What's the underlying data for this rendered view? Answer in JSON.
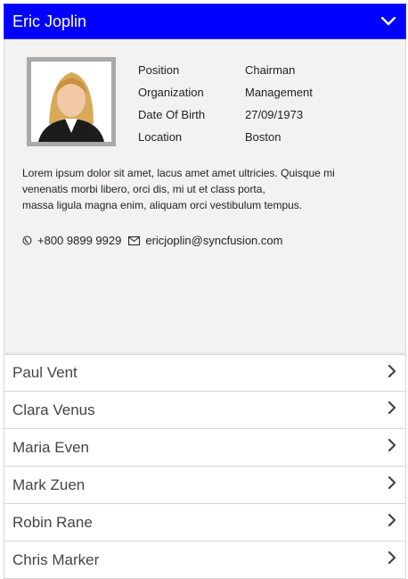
{
  "accordion": {
    "expanded": {
      "name": "Eric Joplin",
      "details": [
        {
          "label": "Position",
          "value": "Chairman"
        },
        {
          "label": "Organization",
          "value": "Management"
        },
        {
          "label": "Date Of Birth",
          "value": "27/09/1973"
        },
        {
          "label": "Location",
          "value": "Boston"
        }
      ],
      "bio_lines": [
        "Lorem ipsum dolor sit amet, lacus amet amet ultricies. Quisque mi",
        "venenatis morbi libero, orci dis, mi ut et class porta,",
        "massa ligula magna enim, aliquam orci vestibulum tempus."
      ],
      "phone": "+800 9899 9929",
      "email": "ericjoplin@syncfusion.com"
    },
    "items": [
      {
        "label": "Paul Vent"
      },
      {
        "label": "Clara Venus"
      },
      {
        "label": "Maria Even"
      },
      {
        "label": "Mark Zuen"
      },
      {
        "label": "Robin Rane"
      },
      {
        "label": "Chris Marker"
      }
    ]
  },
  "colors": {
    "header_bg": "#0000ff",
    "panel_bg": "#f3f2f1"
  },
  "icons": {
    "expanded_chevron": "chevron-down-icon",
    "item_chevron": "chevron-right-icon",
    "phone": "phone-icon",
    "email": "mail-icon"
  }
}
